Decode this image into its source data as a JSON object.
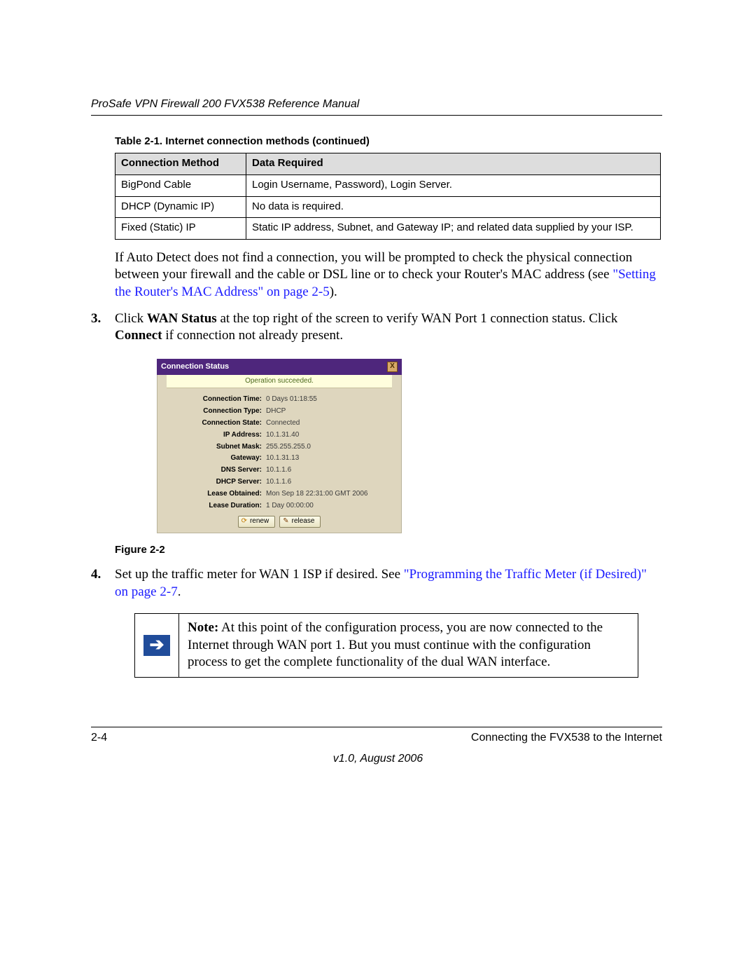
{
  "running_header": "ProSafe VPN Firewall 200 FVX538 Reference Manual",
  "table_caption": "Table 2-1. Internet connection methods (continued)",
  "table_headers": {
    "c1": "Connection Method",
    "c2": "Data Required"
  },
  "table_rows": [
    {
      "method": "BigPond Cable",
      "data": "Login Username, Password), Login Server."
    },
    {
      "method": "DHCP (Dynamic IP)",
      "data": "No data is required."
    },
    {
      "method": "Fixed (Static) IP",
      "data": "Static IP address, Subnet, and Gateway IP; and related data supplied by your ISP."
    }
  ],
  "auto_detect_para": {
    "pre": "If Auto Detect does not find a connection, you will be prompted to check the physical connection between your firewall and the cable or DSL line or to check your Router's MAC address (see ",
    "link": "\"Setting the Router's MAC Address\" on page 2-5",
    "post": ")."
  },
  "step3": {
    "num": "3.",
    "t1": "Click ",
    "b1": "WAN Status",
    "t2": " at the top right of the screen to verify WAN Port 1 connection status. Click ",
    "b2": "Connect",
    "t3": " if connection not already present."
  },
  "cs": {
    "title": "Connection Status",
    "close": "X",
    "msg": "Operation succeeded.",
    "rows": [
      {
        "label": "Connection Time:",
        "value": "0 Days 01:18:55"
      },
      {
        "label": "Connection Type:",
        "value": "DHCP"
      },
      {
        "label": "Connection State:",
        "value": "Connected"
      },
      {
        "label": "IP Address:",
        "value": "10.1.31.40"
      },
      {
        "label": "Subnet Mask:",
        "value": "255.255.255.0"
      },
      {
        "label": "Gateway:",
        "value": "10.1.31.13"
      },
      {
        "label": "DNS Server:",
        "value": "10.1.1.6"
      },
      {
        "label": "DHCP Server:",
        "value": "10.1.1.6"
      },
      {
        "label": "Lease Obtained:",
        "value": "Mon Sep 18 22:31:00 GMT 2006"
      },
      {
        "label": "Lease Duration:",
        "value": "1 Day 00:00:00"
      }
    ],
    "btn_renew": "renew",
    "btn_release": "release"
  },
  "figure_caption": "Figure 2-2",
  "step4": {
    "num": "4.",
    "t1": "Set up the traffic meter for WAN 1 ISP if desired. See ",
    "link": "\"Programming the Traffic Meter (if Desired)\" on page 2-7",
    "t2": "."
  },
  "note": {
    "label": "Note:",
    "text": " At this point of the configuration process, you are now connected to the Internet through WAN port 1. But you must continue with the configuration process to get the complete functionality of the dual WAN interface."
  },
  "footer_left": "2-4",
  "footer_right": "Connecting the FVX538 to the Internet",
  "footer_version": "v1.0, August 2006"
}
